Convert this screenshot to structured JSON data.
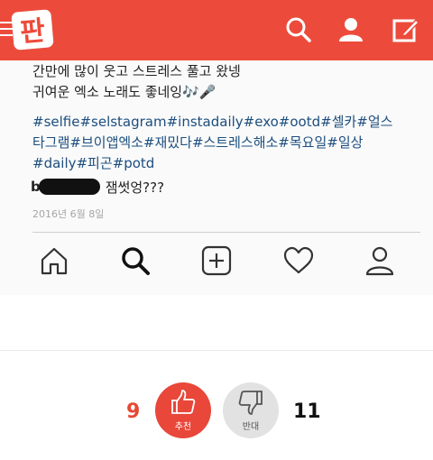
{
  "header": {
    "logo_text": "판",
    "icons": [
      "menu-icon",
      "search-icon",
      "profile-icon",
      "write-icon"
    ]
  },
  "post": {
    "caption_lines": [
      "간만에 많이 웃고 스트레스 풀고 왔넹",
      "귀여운 엑소 노래도 좋네잉🎶🎤"
    ],
    "hashtag_lines": [
      "#selfie#selstagram#instadaily#exo#ootd#셀카#얼스",
      "타그램#브이앱엑소#재밌다#스트레스해소#목요일#일상",
      "#daily#피곤#potd"
    ],
    "comment": {
      "user_initial": "b",
      "text": "잼썻엉???"
    },
    "date": "2016년 6월 8일",
    "tab_icons": [
      "home-icon",
      "search-icon",
      "add-post-icon",
      "heart-icon",
      "profile-icon"
    ]
  },
  "votes": {
    "up_count": "9",
    "up_label": "추천",
    "down_count": "11",
    "down_label": "반대"
  },
  "colors": {
    "brand": "#ec4b3b",
    "hashtag": "#1c4e7e",
    "vote_up": "#e8473a",
    "vote_down_bg": "#e2e2e2"
  }
}
